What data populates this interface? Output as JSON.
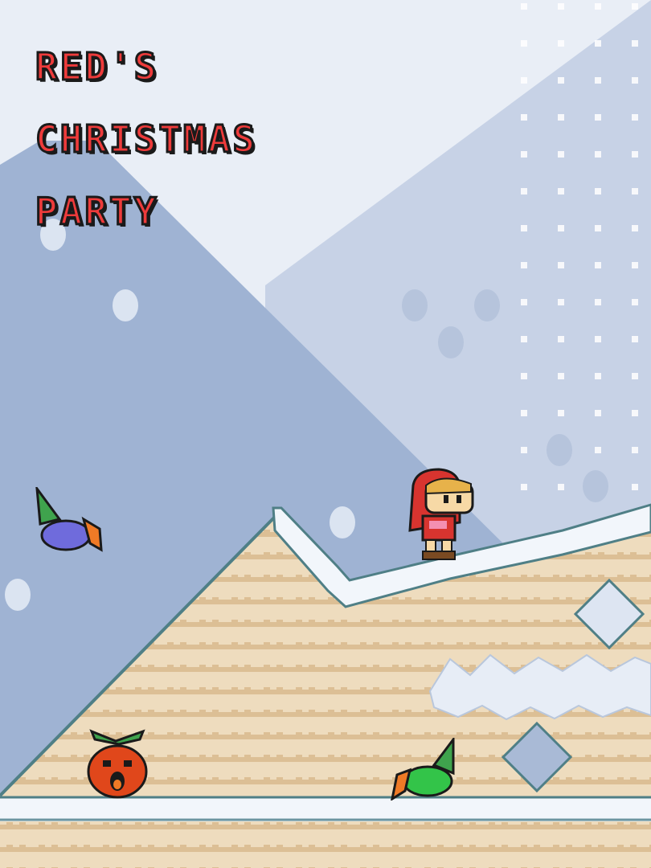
{
  "game": {
    "title_lines": [
      "RED'S",
      "CHRISTMAS",
      "PARTY"
    ]
  },
  "colors": {
    "title_red": "#ee3b3b",
    "sky": "#e9eef6",
    "mountain_back": "#c7d2e6",
    "mountain_front": "#9fb3d3",
    "snow": "#f2f6fb",
    "snow_edge": "#4f7f86",
    "ground_light": "#eedcbe",
    "ground_stripe": "#dcbf95",
    "hero_red": "#d8342f"
  },
  "sprites": {
    "player": "red-hooded-girl",
    "enemy_flying": "blue-elf-sprite",
    "enemy_ground": "green-elf-sprite",
    "enemy_pumpkin": "orange-pumpkin-creature"
  }
}
